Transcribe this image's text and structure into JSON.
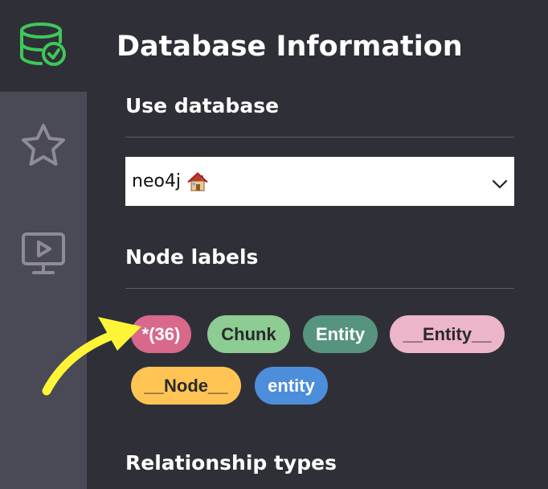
{
  "sidebar": {
    "items": [
      {
        "icon": "database-check-icon",
        "active": true
      },
      {
        "icon": "star-icon",
        "active": false
      },
      {
        "icon": "monitor-play-icon",
        "active": false
      }
    ],
    "active_color": "#3ec85a"
  },
  "panel": {
    "title": "Database Information",
    "use_database": {
      "heading": "Use database",
      "selected_value": "neo4j",
      "selected_icon": "house-emoji-icon"
    },
    "node_labels": {
      "heading": "Node labels",
      "chips": [
        {
          "label": "*(36)",
          "color": "#d8698b",
          "text_color": "#ffffff"
        },
        {
          "label": "Chunk",
          "color": "#8dcc93",
          "text_color": "#2a2a2a"
        },
        {
          "label": "Entity",
          "color": "#57947f",
          "text_color": "#ffffff"
        },
        {
          "label": "__Entity__",
          "color": "#ecb5c9",
          "text_color": "#2a2a2a"
        },
        {
          "label": "__Node__",
          "color": "#ffc454",
          "text_color": "#2a2a2a"
        },
        {
          "label": "entity",
          "color": "#4c8eda",
          "text_color": "#ffffff"
        }
      ]
    },
    "relationship_types": {
      "heading": "Relationship types"
    }
  },
  "annotation": {
    "icon": "yellow-arrow-icon",
    "color": "#fff538"
  }
}
